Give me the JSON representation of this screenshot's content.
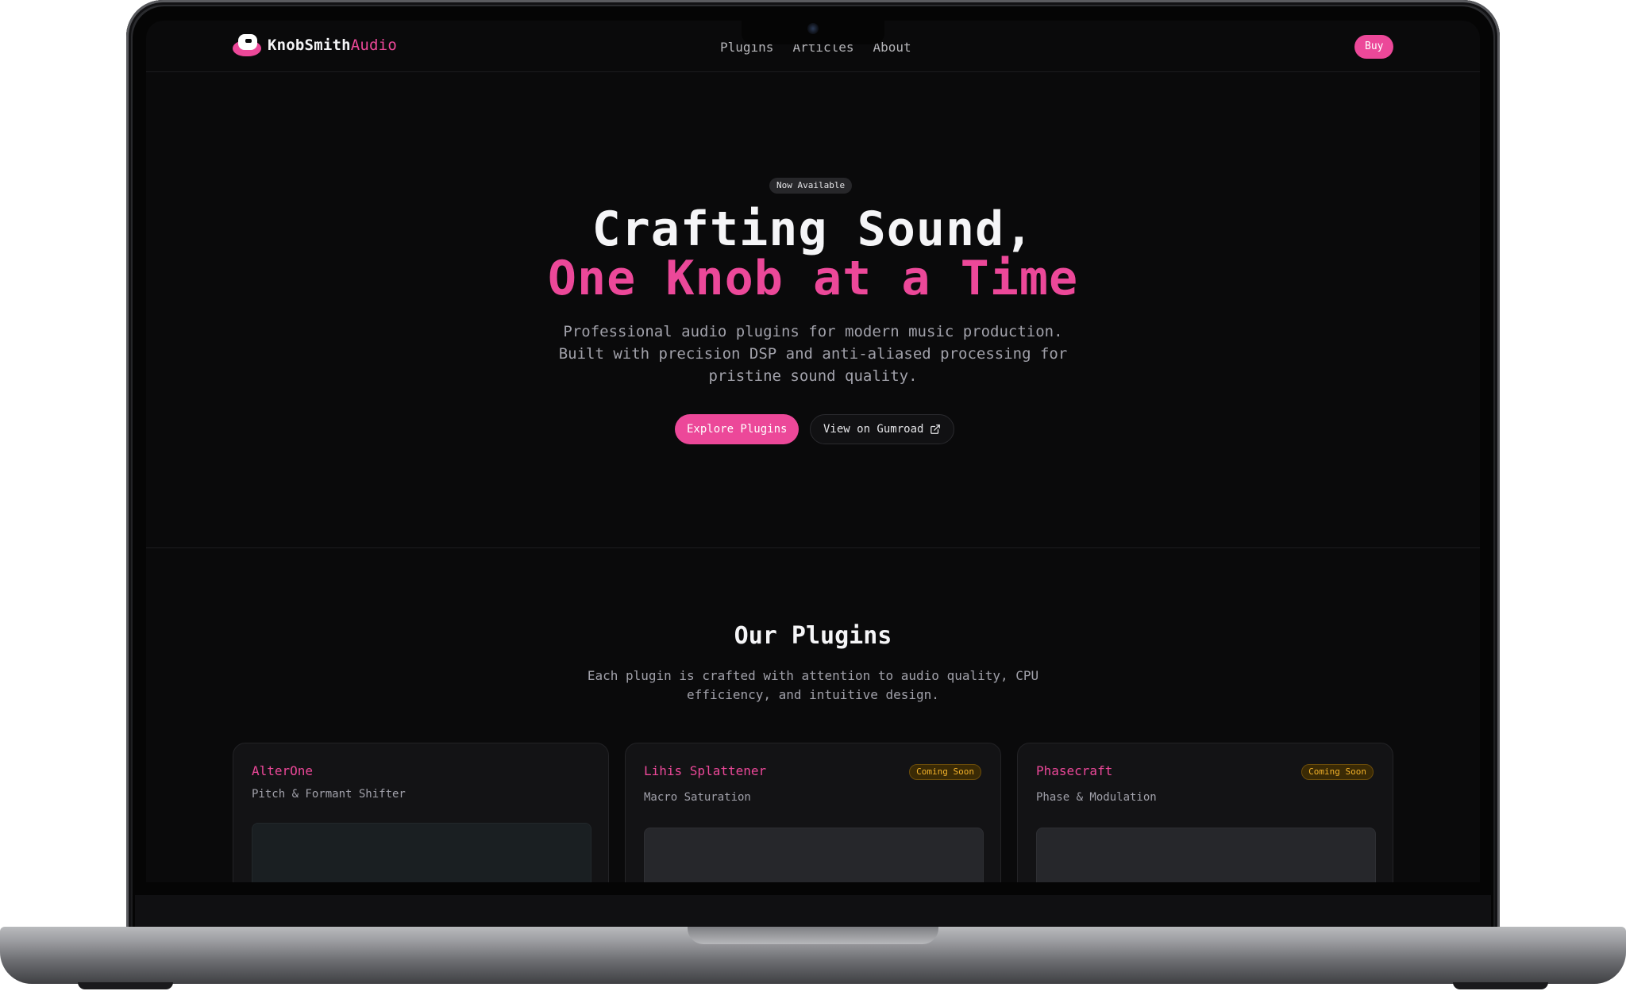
{
  "nav": {
    "logo_primary": "KnobSmith",
    "logo_accent": "Audio",
    "links": [
      "Plugins",
      "Articles",
      "About"
    ],
    "buy_label": "Buy"
  },
  "hero": {
    "badge": "Now Available",
    "title_line1": "Crafting Sound,",
    "title_line2": "One Knob at a Time",
    "subtitle": "Professional audio plugins for modern music production. Built with precision DSP and anti-aliased processing for pristine sound quality.",
    "primary_cta": "Explore Plugins",
    "secondary_cta": "View on Gumroad"
  },
  "plugins_section": {
    "title": "Our Plugins",
    "subtitle": "Each plugin is crafted with attention to audio quality, CPU efficiency, and intuitive design.",
    "cards": [
      {
        "name": "AlterOne",
        "description": "Pitch & Formant Shifter",
        "badge": ""
      },
      {
        "name": "Lihis Splattener",
        "description": "Macro Saturation",
        "badge": "Coming Soon"
      },
      {
        "name": "Phasecraft",
        "description": "Phase & Modulation",
        "badge": "Coming Soon"
      }
    ]
  },
  "colors": {
    "accent": "#ec4899",
    "background": "#0a0a0b",
    "badge_warning": "#f2b12a"
  },
  "icons": {
    "external_link": "external-link-icon",
    "logo": "knob-logo-icon"
  }
}
